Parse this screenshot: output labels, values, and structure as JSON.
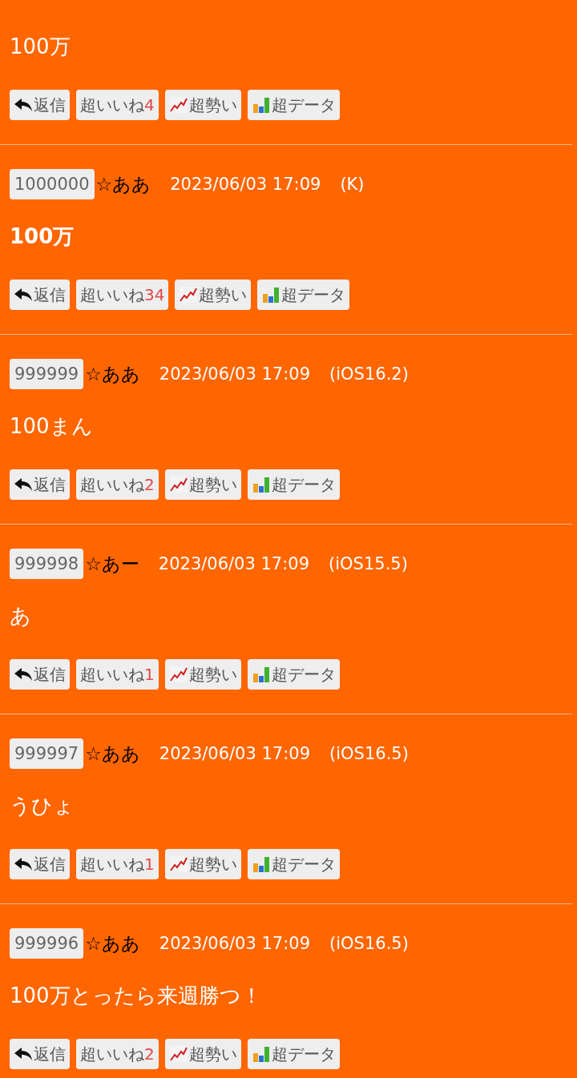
{
  "posts": [
    {
      "partial": true,
      "body": "100万",
      "bold": false,
      "actions": [
        {
          "kind": "reply",
          "label": "返信"
        },
        {
          "kind": "like",
          "label": "超いいね",
          "count": "4"
        },
        {
          "kind": "trend",
          "label": "超勢い"
        },
        {
          "kind": "data",
          "label": "超データ"
        }
      ]
    },
    {
      "partial": false,
      "number": "1000000",
      "name": "☆ああ",
      "datetime": "2023/06/03 17:09",
      "device": "(K)",
      "body": "100万",
      "bold": true,
      "actions": [
        {
          "kind": "reply",
          "label": "返信"
        },
        {
          "kind": "like",
          "label": "超いいね",
          "count": "34"
        },
        {
          "kind": "trend",
          "label": "超勢い"
        },
        {
          "kind": "data",
          "label": "超データ"
        }
      ]
    },
    {
      "partial": false,
      "number": "999999",
      "name": "☆ああ",
      "datetime": "2023/06/03 17:09",
      "device": "(iOS16.2)",
      "body": "100まん",
      "bold": false,
      "actions": [
        {
          "kind": "reply",
          "label": "返信"
        },
        {
          "kind": "like",
          "label": "超いいね",
          "count": "2"
        },
        {
          "kind": "trend",
          "label": "超勢い"
        },
        {
          "kind": "data",
          "label": "超データ"
        }
      ]
    },
    {
      "partial": false,
      "number": "999998",
      "name": "☆あー",
      "datetime": "2023/06/03 17:09",
      "device": "(iOS15.5)",
      "body": "あ",
      "bold": false,
      "actions": [
        {
          "kind": "reply",
          "label": "返信"
        },
        {
          "kind": "like",
          "label": "超いいね",
          "count": "1"
        },
        {
          "kind": "trend",
          "label": "超勢い"
        },
        {
          "kind": "data",
          "label": "超データ"
        }
      ]
    },
    {
      "partial": false,
      "number": "999997",
      "name": "☆ああ",
      "datetime": "2023/06/03 17:09",
      "device": "(iOS16.5)",
      "body": "うひょ",
      "bold": false,
      "actions": [
        {
          "kind": "reply",
          "label": "返信"
        },
        {
          "kind": "like",
          "label": "超いいね",
          "count": "1"
        },
        {
          "kind": "trend",
          "label": "超勢い"
        },
        {
          "kind": "data",
          "label": "超データ"
        }
      ]
    },
    {
      "partial": false,
      "number": "999996",
      "name": "☆ああ",
      "datetime": "2023/06/03 17:09",
      "device": "(iOS16.5)",
      "body": "100万とったら来週勝つ！",
      "bold": false,
      "actions": [
        {
          "kind": "reply",
          "label": "返信"
        },
        {
          "kind": "like",
          "label": "超いいね",
          "count": "2"
        },
        {
          "kind": "trend",
          "label": "超勢い"
        },
        {
          "kind": "data",
          "label": "超データ"
        }
      ]
    }
  ]
}
